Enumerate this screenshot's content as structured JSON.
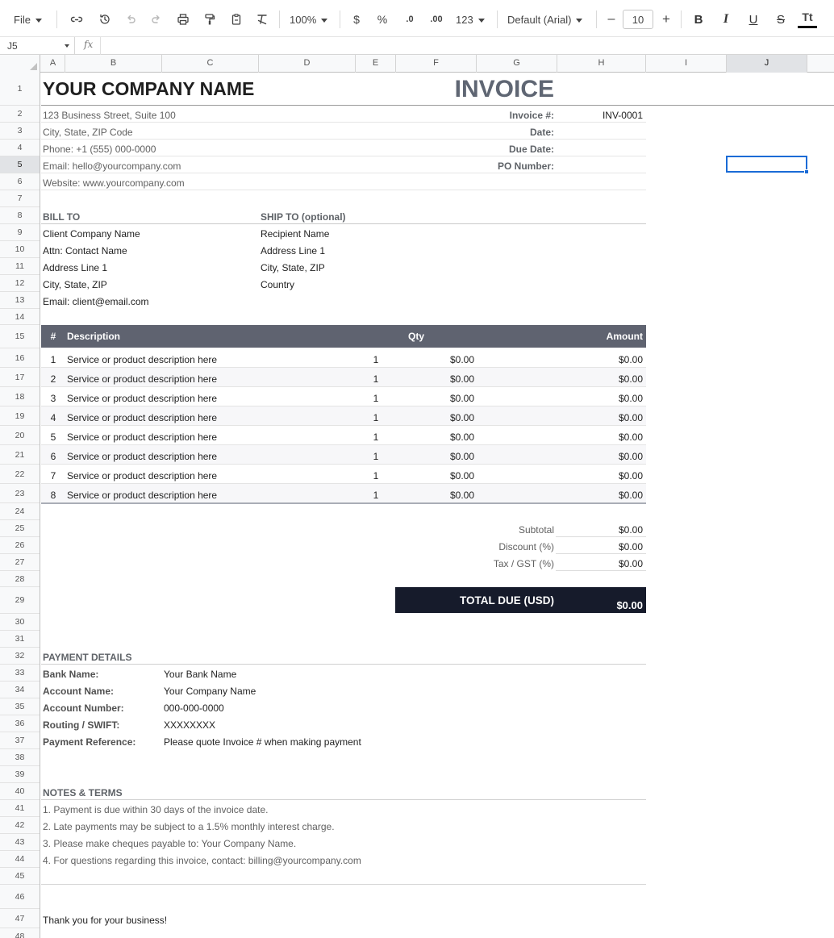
{
  "toolbar": {
    "file_label": "File",
    "zoom_label": "100%",
    "currency_symbol": "$",
    "percent_symbol": "%",
    "decrease_decimals": ".0",
    "increase_decimals": ".00",
    "number_format_label": "123",
    "font_label": "Default (Arial)",
    "font_size_value": "10",
    "minus_label": "–",
    "plus_label": "+",
    "bold_label": "B",
    "italic_label": "I",
    "underline_label": "U",
    "strike_label": "S",
    "text_format_label": "Tt"
  },
  "formula_bar": {
    "cell_ref": "J5",
    "fx_label": "fx",
    "value": ""
  },
  "columns": [
    "A",
    "B",
    "C",
    "D",
    "E",
    "F",
    "G",
    "H",
    "I",
    "J"
  ],
  "selected_column": "J",
  "rows": [
    "1",
    "2",
    "3",
    "4",
    "5",
    "6",
    "7",
    "8",
    "9",
    "10",
    "11",
    "12",
    "13",
    "14",
    "15",
    "16",
    "17",
    "18",
    "19",
    "20",
    "21",
    "22",
    "23",
    "24",
    "25",
    "26",
    "27",
    "28",
    "29",
    "30",
    "31",
    "32",
    "33",
    "34",
    "35",
    "36",
    "37",
    "38",
    "39",
    "40",
    "41",
    "42",
    "43",
    "44",
    "45",
    "46",
    "47",
    "48"
  ],
  "selected_row": "5",
  "invoice": {
    "company_name": "YOUR COMPANY NAME",
    "title": "INVOICE",
    "address_line": "123 Business Street, Suite 100",
    "city_line": "City, State, ZIP Code",
    "phone": "Phone: +1 (555) 000-0000",
    "email": "Email: hello@yourcompany.com",
    "website": "Website: www.yourcompany.com",
    "meta": {
      "invoice_no_label": "Invoice #:",
      "invoice_no_value": "INV-0001",
      "date_label": "Date:",
      "due_label": "Due Date:",
      "po_label": "PO Number:"
    },
    "bill_to": {
      "heading": "BILL TO",
      "lines": [
        "Client Company Name",
        "Attn: Contact Name",
        "Address Line 1",
        "City, State, ZIP",
        "Email: client@email.com"
      ]
    },
    "ship_to": {
      "heading": "SHIP TO (optional)",
      "lines": [
        "Recipient Name",
        "Address Line 1",
        "City, State, ZIP",
        "Country"
      ]
    },
    "items_header": {
      "num": "#",
      "description": "Description",
      "qty": "Qty",
      "amount": "Amount"
    },
    "items": [
      {
        "num": "1",
        "description": "Service or product description here",
        "qty": "1",
        "price": "$0.00",
        "amount": "$0.00"
      },
      {
        "num": "2",
        "description": "Service or product description here",
        "qty": "1",
        "price": "$0.00",
        "amount": "$0.00"
      },
      {
        "num": "3",
        "description": "Service or product description here",
        "qty": "1",
        "price": "$0.00",
        "amount": "$0.00"
      },
      {
        "num": "4",
        "description": "Service or product description here",
        "qty": "1",
        "price": "$0.00",
        "amount": "$0.00"
      },
      {
        "num": "5",
        "description": "Service or product description here",
        "qty": "1",
        "price": "$0.00",
        "amount": "$0.00"
      },
      {
        "num": "6",
        "description": "Service or product description here",
        "qty": "1",
        "price": "$0.00",
        "amount": "$0.00"
      },
      {
        "num": "7",
        "description": "Service or product description here",
        "qty": "1",
        "price": "$0.00",
        "amount": "$0.00"
      },
      {
        "num": "8",
        "description": "Service or product description here",
        "qty": "1",
        "price": "$0.00",
        "amount": "$0.00"
      }
    ],
    "totals": {
      "subtotal_label": "Subtotal",
      "subtotal_value": "$0.00",
      "discount_label": "Discount (%)",
      "discount_value": "$0.00",
      "tax_label": "Tax / GST (%)",
      "tax_value": "$0.00",
      "total_label": "TOTAL DUE (USD)",
      "total_value": "$0.00"
    },
    "payment": {
      "heading": "PAYMENT DETAILS",
      "rows": [
        {
          "label": "Bank Name:",
          "value": "Your Bank Name"
        },
        {
          "label": "Account Name:",
          "value": "Your Company Name"
        },
        {
          "label": "Account Number:",
          "value": "000-000-0000"
        },
        {
          "label": "Routing / SWIFT:",
          "value": "XXXXXXXX"
        },
        {
          "label": "Payment Reference:",
          "value": "Please quote Invoice # when making payment"
        }
      ]
    },
    "notes": {
      "heading": "NOTES & TERMS",
      "lines": [
        "1. Payment is due within 30 days of the invoice date.",
        "2. Late payments may be subject to a 1.5% monthly interest charge.",
        "3. Please make cheques payable to: Your Company Name.",
        "4. For questions regarding this invoice, contact: billing@yourcompany.com"
      ]
    },
    "thanks": "Thank you for your business!"
  },
  "colors": {
    "accent": "#1a6bd6",
    "items_header_bg": "#5f6370",
    "total_bg": "#161b2b",
    "title": "#5f6673"
  }
}
